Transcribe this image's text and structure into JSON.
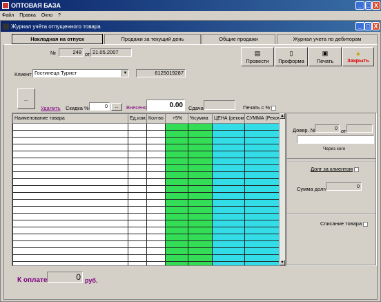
{
  "app": {
    "title": "ОПТОВАЯ БАЗА",
    "window_controls": [
      "_",
      "□",
      "X"
    ]
  },
  "menu": [
    "Файл",
    "Правка",
    "Окно",
    "?"
  ],
  "form": {
    "title": "Журнал учёта отпущенного товара",
    "window_controls": [
      "_",
      "□",
      "X"
    ]
  },
  "tabs": [
    "Накладная на отпуск",
    "Продажи за текущий день",
    "Общие продажи",
    "Журнал учета по дебиторам"
  ],
  "invoice": {
    "number_label": "№",
    "number": "248",
    "date_label": "от",
    "date": "21.05.2007"
  },
  "client": {
    "label": "Клиент",
    "value": "Гостинеца Турист",
    "code": "6125019287"
  },
  "toolbar": {
    "post": "Провести",
    "proforma": "Проформа",
    "print": "Печать",
    "close": "Закрыть"
  },
  "line": {
    "add_button": "...",
    "delete": "Удалить",
    "discount_label": "Скидка %",
    "discount_value": "0",
    "discount_button": "...",
    "paid_label": "Внесено",
    "paid_value": "0.00",
    "change_label": "Сдача",
    "change_value": "",
    "print_pct_label": "Печать с %"
  },
  "table": {
    "columns": [
      "Наименование товара",
      "Ед.изм.",
      "Кол-во",
      "+5%",
      "%сумма",
      "ЦЕНА (реком.)",
      "СУММА (Реком.)"
    ],
    "row_count": 21
  },
  "side": {
    "doc_label": "Довер. №",
    "doc_number": "0",
    "doc_date_label": "от",
    "doc_date": "",
    "via_label": "Через кого",
    "debt_label": "Долг за клиентом",
    "debt_sum_label": "Сумма долга",
    "debt_sum": "0",
    "writeoff_label": "Списание товара"
  },
  "total": {
    "label": "К оплате:",
    "value": "0",
    "currency": "руб."
  },
  "colors": {
    "green": "#33dd55",
    "cyan": "#33dde8",
    "accent": "#800080",
    "close_text": "#dd0000"
  }
}
